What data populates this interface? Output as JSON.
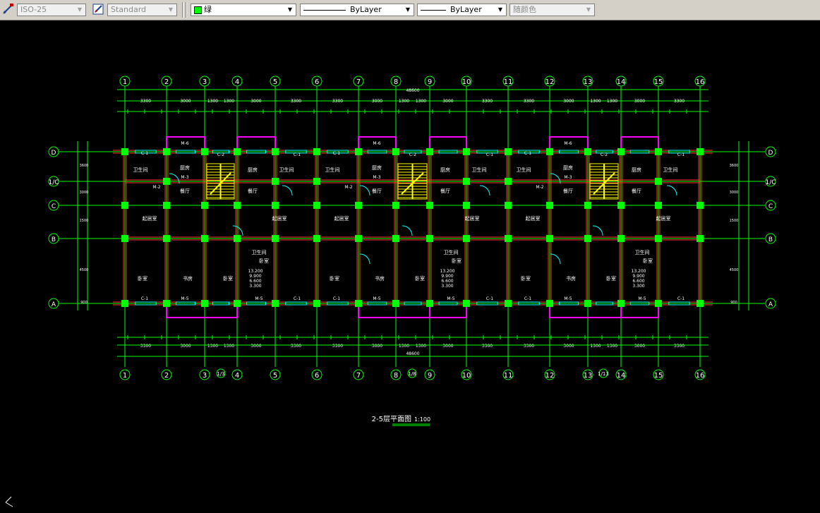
{
  "toolbar": {
    "dimstyle": "ISO-25",
    "textstyle": "Standard",
    "layer": "绿",
    "linetype": "ByLayer",
    "lineweight": "ByLayer",
    "plotstyle": "随颜色",
    "colors": {
      "toolbar_bg": "#d4d0c8",
      "layer_swatch": "#00ff00"
    }
  },
  "drawing": {
    "grid_top": [
      "1",
      "2",
      "3",
      "4",
      "5",
      "6",
      "7",
      "8",
      "9",
      "10",
      "11",
      "12",
      "13",
      "14",
      "15",
      "16"
    ],
    "grid_bottom_extra": [
      "1/3",
      "1/8",
      "1/13"
    ],
    "grid_rows": [
      "D",
      "1/C",
      "C",
      "B",
      "A"
    ],
    "overall_dim": "48600",
    "top_dims": [
      "3300",
      "3000",
      "1300",
      "1300",
      "3000",
      "3300",
      "3300",
      "3000",
      "1300",
      "1300",
      "3000",
      "3300",
      "3300",
      "3000",
      "1300",
      "1300",
      "3000",
      "3300"
    ],
    "bottom_dims": [
      "3300",
      "3000",
      "1300",
      "1300",
      "3000",
      "3300",
      "3300",
      "3000",
      "1300",
      "1300",
      "3000",
      "3300",
      "3300",
      "3000",
      "1300",
      "1300",
      "3000",
      "3300"
    ],
    "side_dims": [
      "3600",
      "3000",
      "1500",
      "4500",
      "900"
    ],
    "rooms": {
      "bathroom": "卫生间",
      "kitchen": "厨房",
      "dining": "餐厅",
      "living": "起居室",
      "bedroom": "卧室",
      "study": "书房"
    },
    "tags": {
      "window_c1": "C-1",
      "window_c2": "C-2",
      "door_m2": "M-2",
      "door_m3": "M-3",
      "door_m5": "M-5",
      "door_m6": "M-6"
    },
    "elevations": [
      "13.200",
      "9.900",
      "6.600",
      "3.300"
    ],
    "title": "2-5层平面图",
    "scale": "1:100",
    "colors": {
      "background": "#000000",
      "axis": "#00ff00",
      "wall": "#ff3030",
      "bay": "#ff00ff",
      "stair": "#ffff00",
      "text": "#ffffff",
      "window": "#00ffff"
    }
  }
}
